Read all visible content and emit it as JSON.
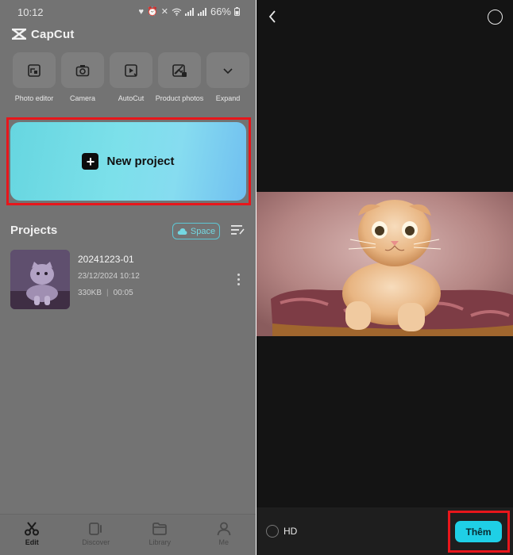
{
  "status_bar": {
    "time": "10:12",
    "battery": "66%"
  },
  "app": {
    "name": "CapCut"
  },
  "tools": [
    {
      "label": "Photo editor",
      "icon": "photo-editor-icon"
    },
    {
      "label": "Camera",
      "icon": "camera-icon"
    },
    {
      "label": "AutoCut",
      "icon": "autocut-icon"
    },
    {
      "label": "Product photos",
      "icon": "product-photos-icon"
    },
    {
      "label": "Expand",
      "icon": "chevron-down-icon"
    }
  ],
  "new_project": {
    "label": "New project"
  },
  "projects": {
    "title": "Projects",
    "space_label": "Space",
    "items": [
      {
        "name": "20241223-01",
        "date": "23/12/2024 10:12",
        "size": "330KB",
        "duration": "00:05"
      }
    ]
  },
  "bottom_nav": [
    {
      "label": "Edit",
      "active": true
    },
    {
      "label": "Discover",
      "active": false
    },
    {
      "label": "Library",
      "active": false
    },
    {
      "label": "Me",
      "active": false
    }
  ],
  "preview": {
    "hd_label": "HD",
    "add_button_label": "Thêm"
  },
  "colors": {
    "accent": "#1fcfe6",
    "highlight_box": "#e8161b",
    "new_project_gradient_start": "#66d6e0",
    "new_project_gradient_end": "#70bff0"
  }
}
